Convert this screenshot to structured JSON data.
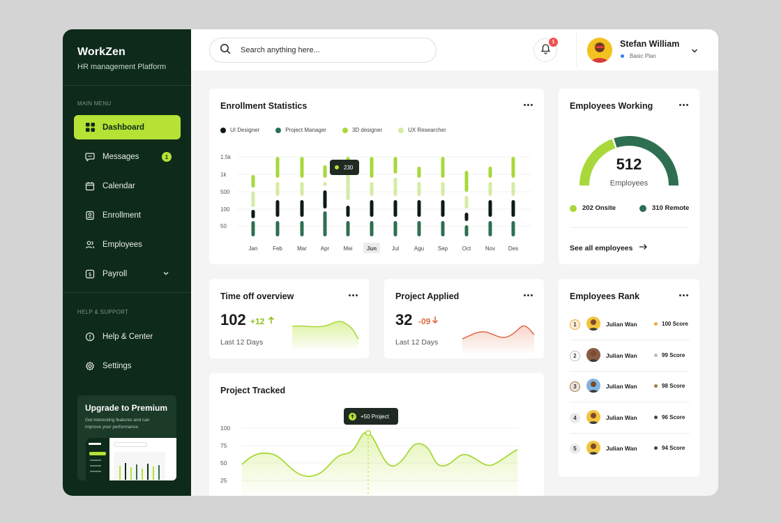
{
  "sidebar": {
    "brand_name": "WorkZen",
    "brand_sub": "HR management Platform",
    "main_menu_label": "MAIN MENU",
    "items": [
      {
        "label": "Dashboard",
        "icon": "grid-icon",
        "active": true
      },
      {
        "label": "Messages",
        "icon": "chat-icon",
        "badge": "1"
      },
      {
        "label": "Calendar",
        "icon": "calendar-icon"
      },
      {
        "label": "Enrollment",
        "icon": "badge-icon"
      },
      {
        "label": "Employees",
        "icon": "users-icon"
      },
      {
        "label": "Payroll",
        "icon": "dollar-icon"
      }
    ],
    "help_label": "HELP & SUPPORT",
    "help_items": [
      {
        "label": "Help & Center",
        "icon": "info-icon"
      },
      {
        "label": "Settings",
        "icon": "gear-icon"
      }
    ],
    "premium": {
      "title": "Upgrade to Premium",
      "text": "Get interesting features and can improve your performance."
    }
  },
  "header": {
    "search_placeholder": "Search anything here...",
    "notification_count": "1",
    "user_name": "Stefan William",
    "user_plan": "Basic Plan"
  },
  "enrollment": {
    "title": "Enrollment Statistics",
    "legend": [
      {
        "label": "UI Designer",
        "color": "#0e1a13"
      },
      {
        "label": "Project Manager",
        "color": "#2e6f51"
      },
      {
        "label": "3D designer",
        "color": "#a8d83a"
      },
      {
        "label": "UX Researcher",
        "color": "#d4eba5"
      }
    ],
    "tooltip_value": "230",
    "chart_data": {
      "type": "bar",
      "y_ticks": [
        "1.5k",
        "1k",
        "500",
        "100",
        "50"
      ],
      "categories": [
        "Jan",
        "Feb",
        "Mar",
        "Apr",
        "Mei",
        "Jun",
        "Jul",
        "Agu",
        "Sep",
        "Oct",
        "Nov",
        "Des"
      ],
      "highlighted": "Jun"
    }
  },
  "employees_working": {
    "title": "Employees Working",
    "total": "512",
    "total_label": "Employees",
    "onsite_label": "202 Onsite",
    "remote_label": "310 Remote",
    "onsite_value": 202,
    "remote_value": 310,
    "link": "See all employees"
  },
  "time_off": {
    "title": "Time off overview",
    "value": "102",
    "delta": "+12",
    "sub": "Last 12 Days"
  },
  "project_applied": {
    "title": "Project Applied",
    "value": "32",
    "delta": "-09",
    "sub": "Last 12 Days"
  },
  "rank": {
    "title": "Employees Rank",
    "rows": [
      {
        "num": "1",
        "name": "Julian Wan",
        "score": "100 Score",
        "color": "#f0a93c"
      },
      {
        "num": "2",
        "name": "Julian Wan",
        "score": "99 Score",
        "color": "#bdbdbd"
      },
      {
        "num": "3",
        "name": "Julian Wan",
        "score": "98 Score",
        "color": "#9b7a4b"
      },
      {
        "num": "4",
        "name": "Julian Wan",
        "score": "96 Score",
        "color": "#444444"
      },
      {
        "num": "5",
        "name": "Julian Wan",
        "score": "94 Score",
        "color": "#444444"
      }
    ]
  },
  "tracked": {
    "title": "Project Tracked",
    "tooltip": "+50 Project",
    "chart_data": {
      "type": "area",
      "y_ticks": [
        "100",
        "75",
        "50",
        "25"
      ]
    }
  }
}
